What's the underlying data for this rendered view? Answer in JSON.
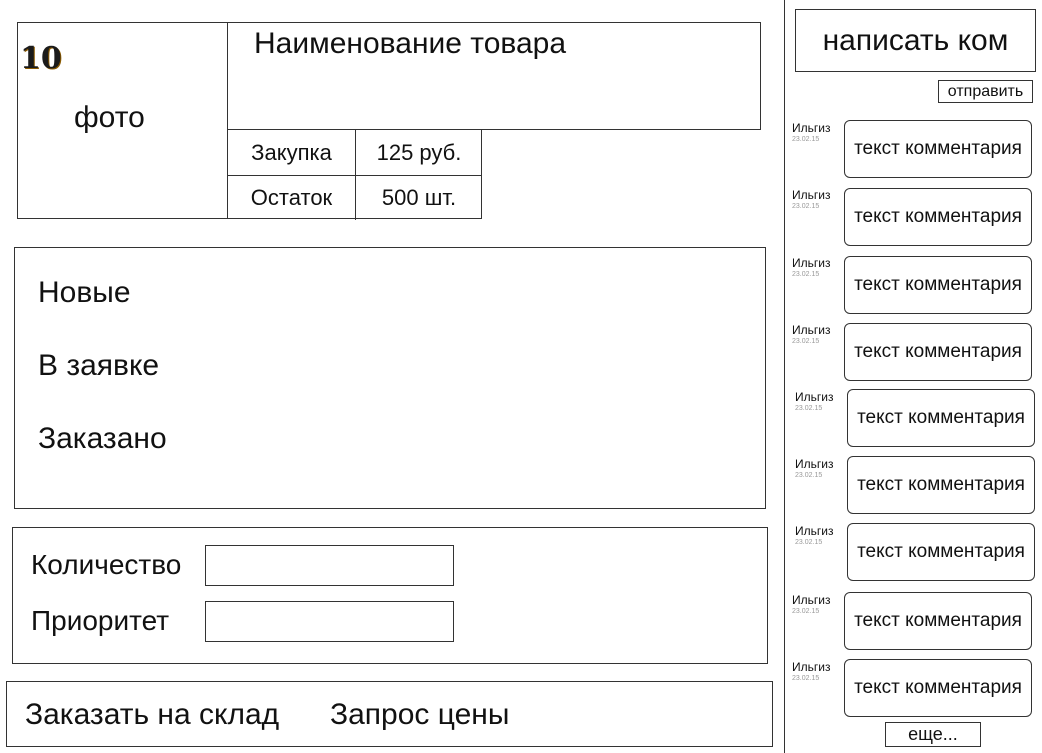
{
  "product": {
    "badge": "10",
    "photo_label": "фото",
    "title": "Наименование товара",
    "info": [
      {
        "label": "Закупка",
        "value": "125 руб."
      },
      {
        "label": "Остаток",
        "value": "500 шт."
      }
    ]
  },
  "statuses": [
    "Новые",
    "В заявке",
    "Заказано"
  ],
  "form": {
    "quantity_label": "Количество",
    "priority_label": "Приоритет",
    "quantity_value": "",
    "priority_value": ""
  },
  "actions": {
    "order_to_warehouse": "Заказать на склад",
    "price_request": "Запрос цены"
  },
  "comments_panel": {
    "input_placeholder": "написать ком",
    "send_label": "отправить",
    "more_label": "еще...",
    "items": [
      {
        "author": "Ильгиз",
        "date": "23.02.15",
        "text": "текст комментария"
      },
      {
        "author": "Ильгиз",
        "date": "23.02.15",
        "text": "текст комментария"
      },
      {
        "author": "Ильгиз",
        "date": "23.02.15",
        "text": "текст комментария"
      },
      {
        "author": "Ильгиз",
        "date": "23.02.15",
        "text": "текст комментария"
      },
      {
        "author": "Ильгиз",
        "date": "23.02.15",
        "text": "текст комментария"
      },
      {
        "author": "Ильгиз",
        "date": "23.02.15",
        "text": "текст комментария"
      },
      {
        "author": "Ильгиз",
        "date": "23.02.15",
        "text": "текст комментария"
      },
      {
        "author": "Ильгиз",
        "date": "23.02.15",
        "text": "текст комментария"
      },
      {
        "author": "Ильгиз",
        "date": "23.02.15",
        "text": "текст комментария"
      }
    ]
  }
}
